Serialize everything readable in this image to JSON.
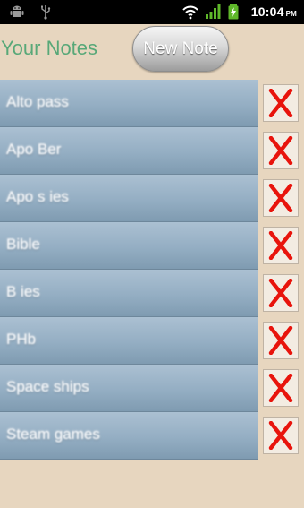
{
  "status_bar": {
    "time": "10:04",
    "ampm": "PM",
    "icons": [
      "android-icon",
      "usb-icon",
      "wifi-icon",
      "signal-icon",
      "battery-charging-icon"
    ]
  },
  "header": {
    "title": "Your Notes",
    "new_note_label": "New Note"
  },
  "notes": [
    {
      "label": "Alto pass"
    },
    {
      "label": "Apo Ber"
    },
    {
      "label": "Apo s ies"
    },
    {
      "label": "Bible"
    },
    {
      "label": "B ies"
    },
    {
      "label": "PHb"
    },
    {
      "label": "Space ships"
    },
    {
      "label": "Steam games"
    }
  ],
  "delete_glyph": "X",
  "colors": {
    "background": "#e7d6bf",
    "title": "#58a878",
    "delete_x": "#e8140c",
    "list_item": "#94aec3"
  }
}
